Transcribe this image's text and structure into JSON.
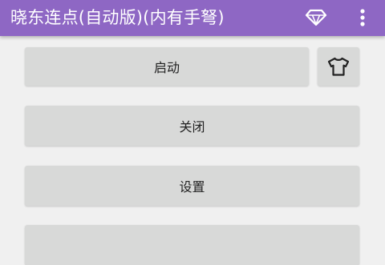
{
  "app_bar": {
    "title": "晓东连点(自动版)(内有手弩)",
    "background_color": "#8e67c4",
    "actions": [
      {
        "icon": "diamond-icon"
      },
      {
        "icon": "more-vert-icon"
      }
    ]
  },
  "main": {
    "buttons": {
      "start_label": "启动",
      "shirt_icon": "shirt-icon",
      "close_label": "关闭",
      "settings_label": "设置"
    }
  }
}
